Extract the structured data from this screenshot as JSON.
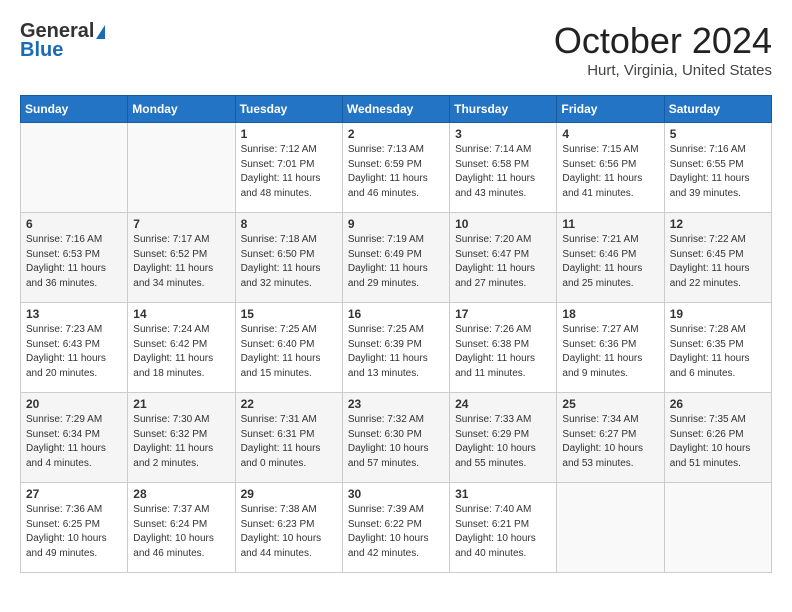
{
  "header": {
    "logo_general": "General",
    "logo_blue": "Blue",
    "month_title": "October 2024",
    "location": "Hurt, Virginia, United States"
  },
  "days_of_week": [
    "Sunday",
    "Monday",
    "Tuesday",
    "Wednesday",
    "Thursday",
    "Friday",
    "Saturday"
  ],
  "weeks": [
    [
      {
        "day": "",
        "info": ""
      },
      {
        "day": "",
        "info": ""
      },
      {
        "day": "1",
        "info": "Sunrise: 7:12 AM\nSunset: 7:01 PM\nDaylight: 11 hours\nand 48 minutes."
      },
      {
        "day": "2",
        "info": "Sunrise: 7:13 AM\nSunset: 6:59 PM\nDaylight: 11 hours\nand 46 minutes."
      },
      {
        "day": "3",
        "info": "Sunrise: 7:14 AM\nSunset: 6:58 PM\nDaylight: 11 hours\nand 43 minutes."
      },
      {
        "day": "4",
        "info": "Sunrise: 7:15 AM\nSunset: 6:56 PM\nDaylight: 11 hours\nand 41 minutes."
      },
      {
        "day": "5",
        "info": "Sunrise: 7:16 AM\nSunset: 6:55 PM\nDaylight: 11 hours\nand 39 minutes."
      }
    ],
    [
      {
        "day": "6",
        "info": "Sunrise: 7:16 AM\nSunset: 6:53 PM\nDaylight: 11 hours\nand 36 minutes."
      },
      {
        "day": "7",
        "info": "Sunrise: 7:17 AM\nSunset: 6:52 PM\nDaylight: 11 hours\nand 34 minutes."
      },
      {
        "day": "8",
        "info": "Sunrise: 7:18 AM\nSunset: 6:50 PM\nDaylight: 11 hours\nand 32 minutes."
      },
      {
        "day": "9",
        "info": "Sunrise: 7:19 AM\nSunset: 6:49 PM\nDaylight: 11 hours\nand 29 minutes."
      },
      {
        "day": "10",
        "info": "Sunrise: 7:20 AM\nSunset: 6:47 PM\nDaylight: 11 hours\nand 27 minutes."
      },
      {
        "day": "11",
        "info": "Sunrise: 7:21 AM\nSunset: 6:46 PM\nDaylight: 11 hours\nand 25 minutes."
      },
      {
        "day": "12",
        "info": "Sunrise: 7:22 AM\nSunset: 6:45 PM\nDaylight: 11 hours\nand 22 minutes."
      }
    ],
    [
      {
        "day": "13",
        "info": "Sunrise: 7:23 AM\nSunset: 6:43 PM\nDaylight: 11 hours\nand 20 minutes."
      },
      {
        "day": "14",
        "info": "Sunrise: 7:24 AM\nSunset: 6:42 PM\nDaylight: 11 hours\nand 18 minutes."
      },
      {
        "day": "15",
        "info": "Sunrise: 7:25 AM\nSunset: 6:40 PM\nDaylight: 11 hours\nand 15 minutes."
      },
      {
        "day": "16",
        "info": "Sunrise: 7:25 AM\nSunset: 6:39 PM\nDaylight: 11 hours\nand 13 minutes."
      },
      {
        "day": "17",
        "info": "Sunrise: 7:26 AM\nSunset: 6:38 PM\nDaylight: 11 hours\nand 11 minutes."
      },
      {
        "day": "18",
        "info": "Sunrise: 7:27 AM\nSunset: 6:36 PM\nDaylight: 11 hours\nand 9 minutes."
      },
      {
        "day": "19",
        "info": "Sunrise: 7:28 AM\nSunset: 6:35 PM\nDaylight: 11 hours\nand 6 minutes."
      }
    ],
    [
      {
        "day": "20",
        "info": "Sunrise: 7:29 AM\nSunset: 6:34 PM\nDaylight: 11 hours\nand 4 minutes."
      },
      {
        "day": "21",
        "info": "Sunrise: 7:30 AM\nSunset: 6:32 PM\nDaylight: 11 hours\nand 2 minutes."
      },
      {
        "day": "22",
        "info": "Sunrise: 7:31 AM\nSunset: 6:31 PM\nDaylight: 11 hours\nand 0 minutes."
      },
      {
        "day": "23",
        "info": "Sunrise: 7:32 AM\nSunset: 6:30 PM\nDaylight: 10 hours\nand 57 minutes."
      },
      {
        "day": "24",
        "info": "Sunrise: 7:33 AM\nSunset: 6:29 PM\nDaylight: 10 hours\nand 55 minutes."
      },
      {
        "day": "25",
        "info": "Sunrise: 7:34 AM\nSunset: 6:27 PM\nDaylight: 10 hours\nand 53 minutes."
      },
      {
        "day": "26",
        "info": "Sunrise: 7:35 AM\nSunset: 6:26 PM\nDaylight: 10 hours\nand 51 minutes."
      }
    ],
    [
      {
        "day": "27",
        "info": "Sunrise: 7:36 AM\nSunset: 6:25 PM\nDaylight: 10 hours\nand 49 minutes."
      },
      {
        "day": "28",
        "info": "Sunrise: 7:37 AM\nSunset: 6:24 PM\nDaylight: 10 hours\nand 46 minutes."
      },
      {
        "day": "29",
        "info": "Sunrise: 7:38 AM\nSunset: 6:23 PM\nDaylight: 10 hours\nand 44 minutes."
      },
      {
        "day": "30",
        "info": "Sunrise: 7:39 AM\nSunset: 6:22 PM\nDaylight: 10 hours\nand 42 minutes."
      },
      {
        "day": "31",
        "info": "Sunrise: 7:40 AM\nSunset: 6:21 PM\nDaylight: 10 hours\nand 40 minutes."
      },
      {
        "day": "",
        "info": ""
      },
      {
        "day": "",
        "info": ""
      }
    ]
  ]
}
